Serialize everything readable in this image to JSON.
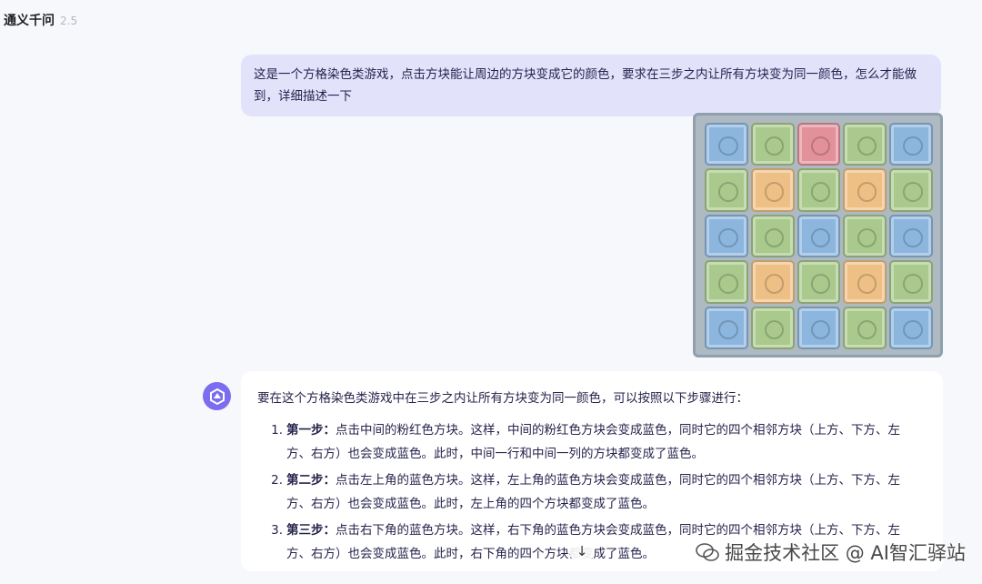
{
  "header": {
    "app_name": "通义千问",
    "version": "2.5"
  },
  "user_message": {
    "text": "这是一个方格染色类游戏，点击方块能让周边的方块变成它的颜色，要求在三步之内让所有方块变为同一颜色，怎么才能做到，详细描述一下"
  },
  "board": {
    "rows": [
      [
        "blue",
        "green",
        "pink",
        "green",
        "blue"
      ],
      [
        "green",
        "orange",
        "green",
        "orange",
        "green"
      ],
      [
        "blue",
        "green",
        "blue",
        "green",
        "blue"
      ],
      [
        "green",
        "orange",
        "green",
        "orange",
        "green"
      ],
      [
        "blue",
        "green",
        "blue",
        "green",
        "blue"
      ]
    ]
  },
  "answer": {
    "intro": "要在这个方格染色类游戏中在三步之内让所有方块变为同一颜色，可以按照以下步骤进行：",
    "steps": [
      {
        "num": "1.",
        "title": "第一步：",
        "text": "点击中间的粉红色方块。这样，中间的粉红色方块会变成蓝色，同时它的四个相邻方块（上方、下方、左方、右方）也会变成蓝色。此时，中间一行和中间一列的方块都变成了蓝色。"
      },
      {
        "num": "2.",
        "title": "第二步：",
        "text": "点击左上角的蓝色方块。这样，左上角的蓝色方块会变成蓝色，同时它的四个相邻方块（上方、下方、左方、右方）也会变成蓝色。此时，左上角的四个方块都变成了蓝色。"
      },
      {
        "num": "3.",
        "title": "第三步：",
        "text": "点击右下角的蓝色方块。这样，右下角的蓝色方块会变成蓝色，同时它的四个相邻方块（上方、下方、左方、右方）也会变成蓝色。此时，右下角的四个方块都变成了蓝色。"
      }
    ]
  },
  "scroll_button": {
    "icon": "arrow-down-icon",
    "glyph": "↓"
  },
  "watermark": {
    "text": "掘金技术社区 @ AI智汇驿站"
  },
  "colors": {
    "accent": "#7b6cf0",
    "user_bubble": "#e3e2fb"
  }
}
